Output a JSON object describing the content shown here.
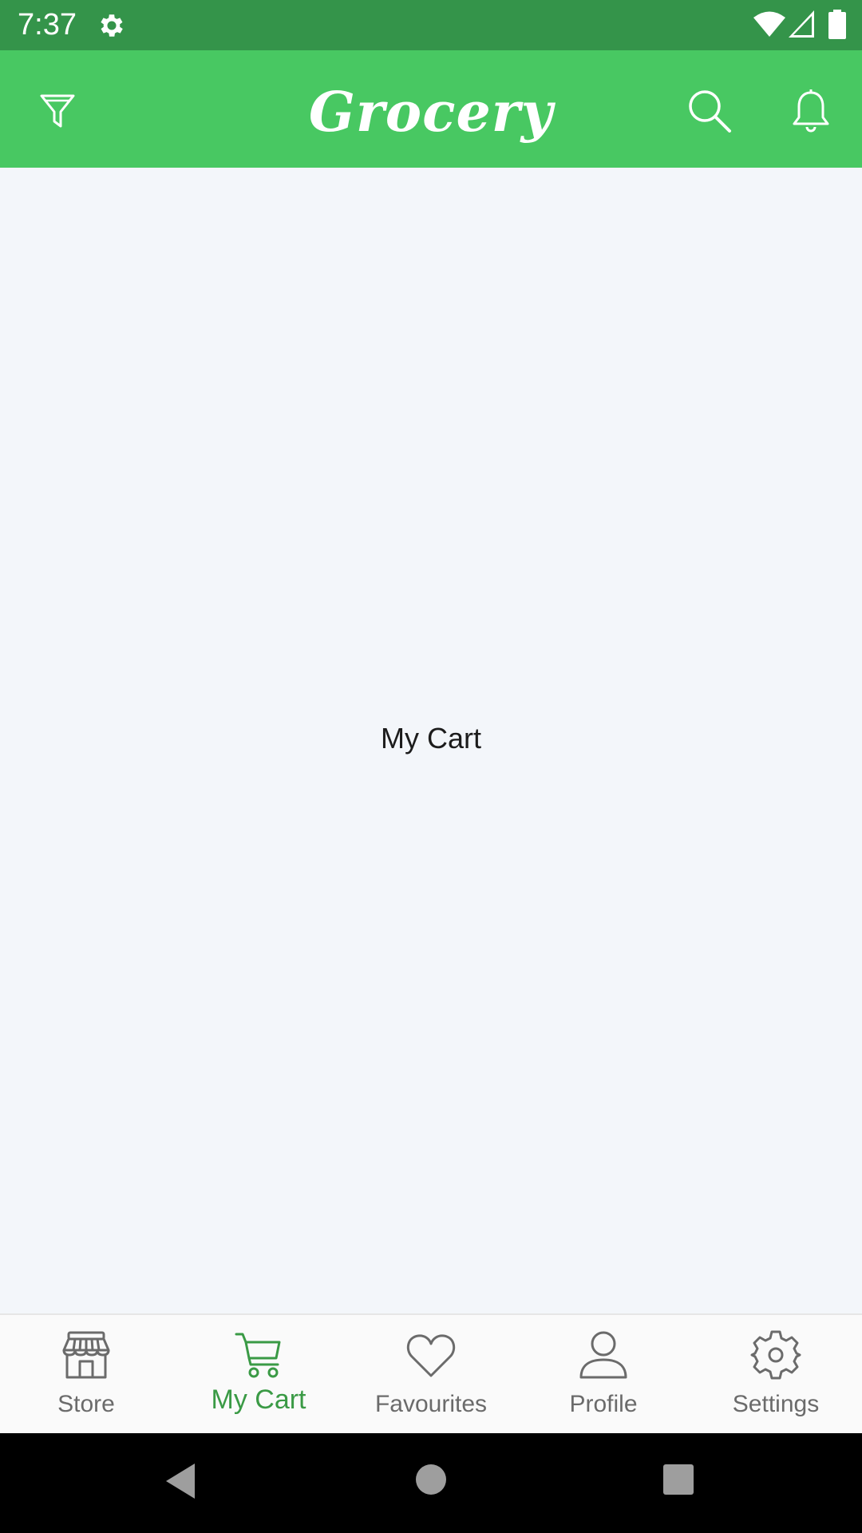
{
  "status_bar": {
    "time": "7:37",
    "icons": [
      "gear-icon",
      "wifi-icon",
      "cellular-signal-icon",
      "battery-icon"
    ]
  },
  "app_bar": {
    "title": "Grocery",
    "left_icon": "filter-funnel-icon",
    "right_icons": [
      "search-icon",
      "notification-bell-icon"
    ],
    "background_color": "#48c862"
  },
  "main": {
    "label": "My Cart"
  },
  "bottom_nav": {
    "active_color": "#3a9a45",
    "inactive_color": "#6b6b6b",
    "items": [
      {
        "label": "Store",
        "icon": "store-icon",
        "active": false
      },
      {
        "label": "My Cart",
        "icon": "cart-icon",
        "active": true
      },
      {
        "label": "Favourites",
        "icon": "heart-icon",
        "active": false
      },
      {
        "label": "Profile",
        "icon": "profile-icon",
        "active": false
      },
      {
        "label": "Settings",
        "icon": "settings-gear-icon",
        "active": false
      }
    ]
  },
  "system_nav": {
    "icons": [
      "back-icon",
      "home-icon",
      "recents-icon"
    ]
  }
}
